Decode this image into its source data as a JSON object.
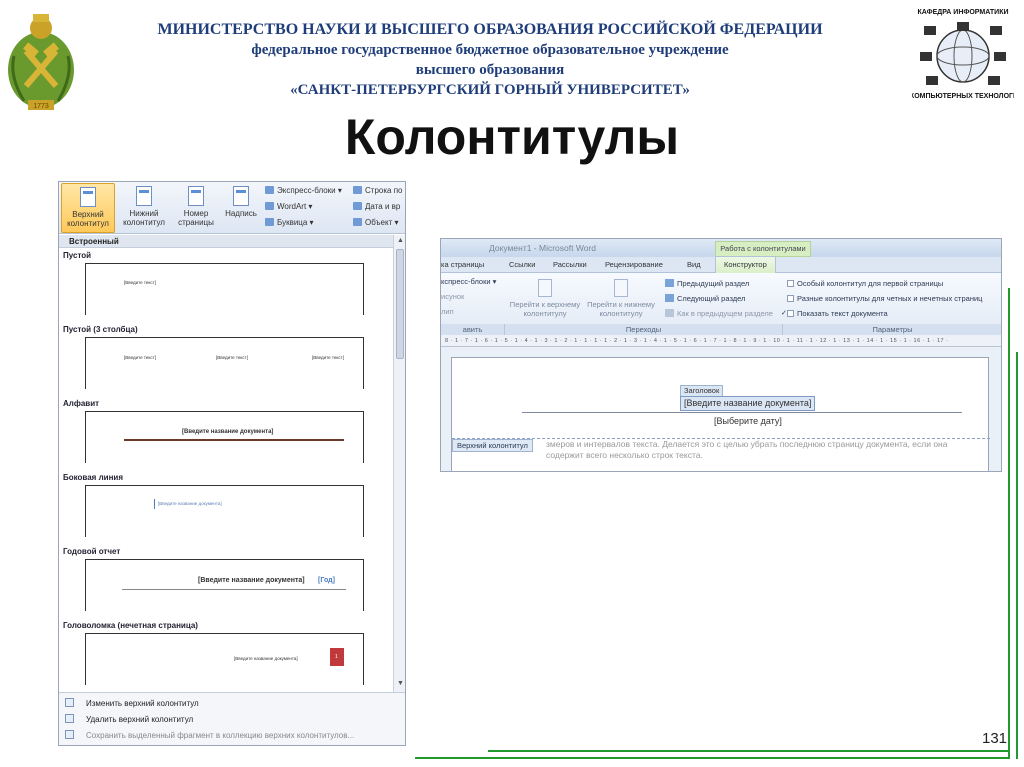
{
  "header": {
    "line1": "МИНИСТЕРСТВО НАУКИ И ВЫСШЕГО ОБРАЗОВАНИЯ РОССИЙСКОЙ ФЕДЕРАЦИИ",
    "line2": "федеральное государственное бюджетное образовательное учреждение",
    "line3": "высшего образования",
    "line4": "«САНКТ-ПЕТЕРБУРГСКИЙ ГОРНЫЙ УНИВЕРСИТЕТ»",
    "emblem_year": "1773",
    "dept_top": "КАФЕДРА ИНФОРМАТИКИ",
    "dept_bottom": "И КОМПЬЮТЕРНЫХ ТЕХНОЛОГИЙ"
  },
  "title": "Колонтитулы",
  "page_number": "131",
  "gallery": {
    "ribbon": {
      "header_btn": "Верхний колонтитул",
      "footer_btn": "Нижний колонтитул",
      "pagenum_btn": "Номер страницы",
      "textbox_btn": "Надпись",
      "express": "Экспресс-блоки",
      "wordart": "WordArt",
      "dropcap": "Буквица",
      "sigline": "Строка по",
      "datetime": "Дата и вр",
      "object": "Объект"
    },
    "section_header": "Встроенный",
    "sections": [
      {
        "label": "Пустой",
        "texts": [
          "[Введите текст]"
        ]
      },
      {
        "label": "Пустой (3 столбца)",
        "texts": [
          "[Введите текст]",
          "[Введите текст]",
          "[Введите текст]"
        ]
      },
      {
        "label": "Алфавит",
        "texts": [
          "[Введите название документа]"
        ]
      },
      {
        "label": "Боковая линия",
        "texts": [
          "[Введите название документа]"
        ]
      },
      {
        "label": "Годовой отчет",
        "texts": [
          "[Введите название документа]",
          "[Год]"
        ]
      },
      {
        "label": "Головоломка (нечетная страница)",
        "texts": [
          "[Введите название документа]",
          "1"
        ]
      }
    ],
    "footer_menu": {
      "edit": "Изменить верхний колонтитул",
      "delete": "Удалить верхний колонтитул",
      "save": "Сохранить выделенный фрагмент в коллекцию верхних колонтитулов..."
    }
  },
  "word": {
    "title": "Документ1 - Microsoft Word",
    "context_tab": "Работа с колонтитулами",
    "tabs": [
      "ка страницы",
      "Ссылки",
      "Рассылки",
      "Рецензирование",
      "Вид",
      "Конструктор"
    ],
    "ribbon": {
      "express": "кспресс-блоки",
      "picture": "исунок",
      "clip": "лип",
      "group_insert": "авить",
      "goto_header": "Перейти к верхнему колонтитулу",
      "goto_footer": "Перейти к нижнему колонтитулу",
      "prev_section": "Предыдущий раздел",
      "next_section": "Следующий раздел",
      "link_prev": "Как в предыдущем разделе",
      "group_nav": "Переходы",
      "opt_first": "Особый колонтитул для первой страницы",
      "opt_oddeven": "Разные колонтитулы для четных и нечетных страниц",
      "opt_showtext": "Показать текст документа",
      "group_params": "Параметры"
    },
    "ruler": "8 · 1 · 7 · 1 · 6 · 1 · 5 · 1 · 4 · 1 · 3 · 1 · 2 · 1 · 1 · 1 · 1 · 2 · 1 · 3 · 1 · 4 · 1 · 5 · 1 · 6 · 1 · 7 · 1 · 8 · 1 · 9 · 1 · 10 · 1 · 11 · 1 · 12 · 1 · 13 · 1 · 14 · 1 · 15 · 1 · 16 · 1 · 17 ·",
    "field_tag": "Заголовок",
    "field_title": "[Введите название документа]",
    "field_date": "[Выберите дату]",
    "header_label": "Верхний колонтитул",
    "body_text": "змеров и интервалов текста. Делается это с целью убрать последнюю страницу документа, если она содержит всего несколько строк текста."
  },
  "colors": {
    "header_blue": "#1f3d7a",
    "green_line": "#1e9a2e",
    "emblem_green": "#5e8f2a",
    "gold": "#c9a227"
  }
}
